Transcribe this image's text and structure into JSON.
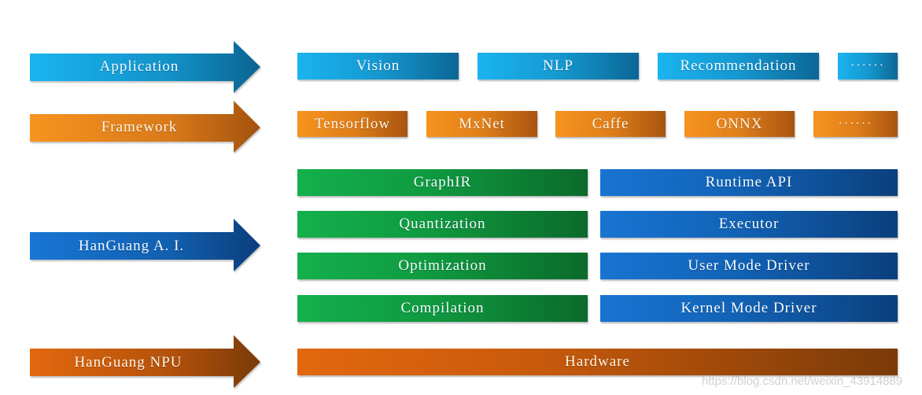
{
  "colors": {
    "application": "#1ab4f0",
    "framework": "#f7931e",
    "hanguang_ai": "#1874d2",
    "hanguang_npu": "#e2680e",
    "compiler_stack": "#14b04c",
    "runtime_stack": "#1874d2"
  },
  "layers": {
    "application": {
      "arrow_label": "Application",
      "items": [
        "Vision",
        "NLP",
        "Recommendation",
        "······"
      ]
    },
    "framework": {
      "arrow_label": "Framework",
      "items": [
        "Tensorflow",
        "MxNet",
        "Caffe",
        "ONNX",
        "······"
      ]
    },
    "hanguang_ai": {
      "arrow_label": "HanGuang A. I.",
      "compiler_stack": [
        "GraphIR",
        "Quantization",
        "Optimization",
        "Compilation"
      ],
      "runtime_stack": [
        "Runtime API",
        "Executor",
        "User Mode Driver",
        "Kernel Mode Driver"
      ]
    },
    "hanguang_npu": {
      "arrow_label": "HanGuang NPU",
      "items": [
        "Hardware"
      ]
    }
  },
  "watermark": "https://blog.csdn.net/weixin_43914889"
}
